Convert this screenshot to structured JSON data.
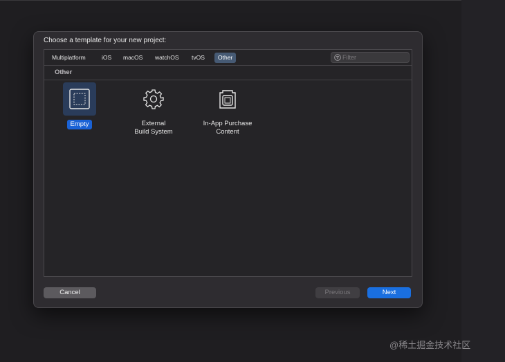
{
  "dialog": {
    "title": "Choose a template for your new project:"
  },
  "tabs": [
    {
      "label": "Multiplatform",
      "selected": false
    },
    {
      "label": "iOS",
      "selected": false
    },
    {
      "label": "macOS",
      "selected": false
    },
    {
      "label": "watchOS",
      "selected": false
    },
    {
      "label": "tvOS",
      "selected": false
    },
    {
      "label": "Other",
      "selected": true
    }
  ],
  "filter": {
    "placeholder": "Filter",
    "value": "",
    "icon": "filter-icon"
  },
  "section": {
    "label": "Other"
  },
  "templates": [
    {
      "name": "Empty",
      "icon": "empty-document-icon",
      "selected": true
    },
    {
      "name_line1": "External",
      "name_line2": "Build System",
      "icon": "gear-icon",
      "selected": false
    },
    {
      "name_line1": "In-App Purchase",
      "name_line2": "Content",
      "icon": "in-app-purchase-icon",
      "selected": false
    }
  ],
  "buttons": {
    "cancel": "Cancel",
    "previous": "Previous",
    "next": "Next"
  },
  "watermark": "@稀土掘金技术社区",
  "colors": {
    "accent": "#1a6fe0",
    "selected_tab": "#465a74",
    "selected_label": "#1a62d6"
  }
}
